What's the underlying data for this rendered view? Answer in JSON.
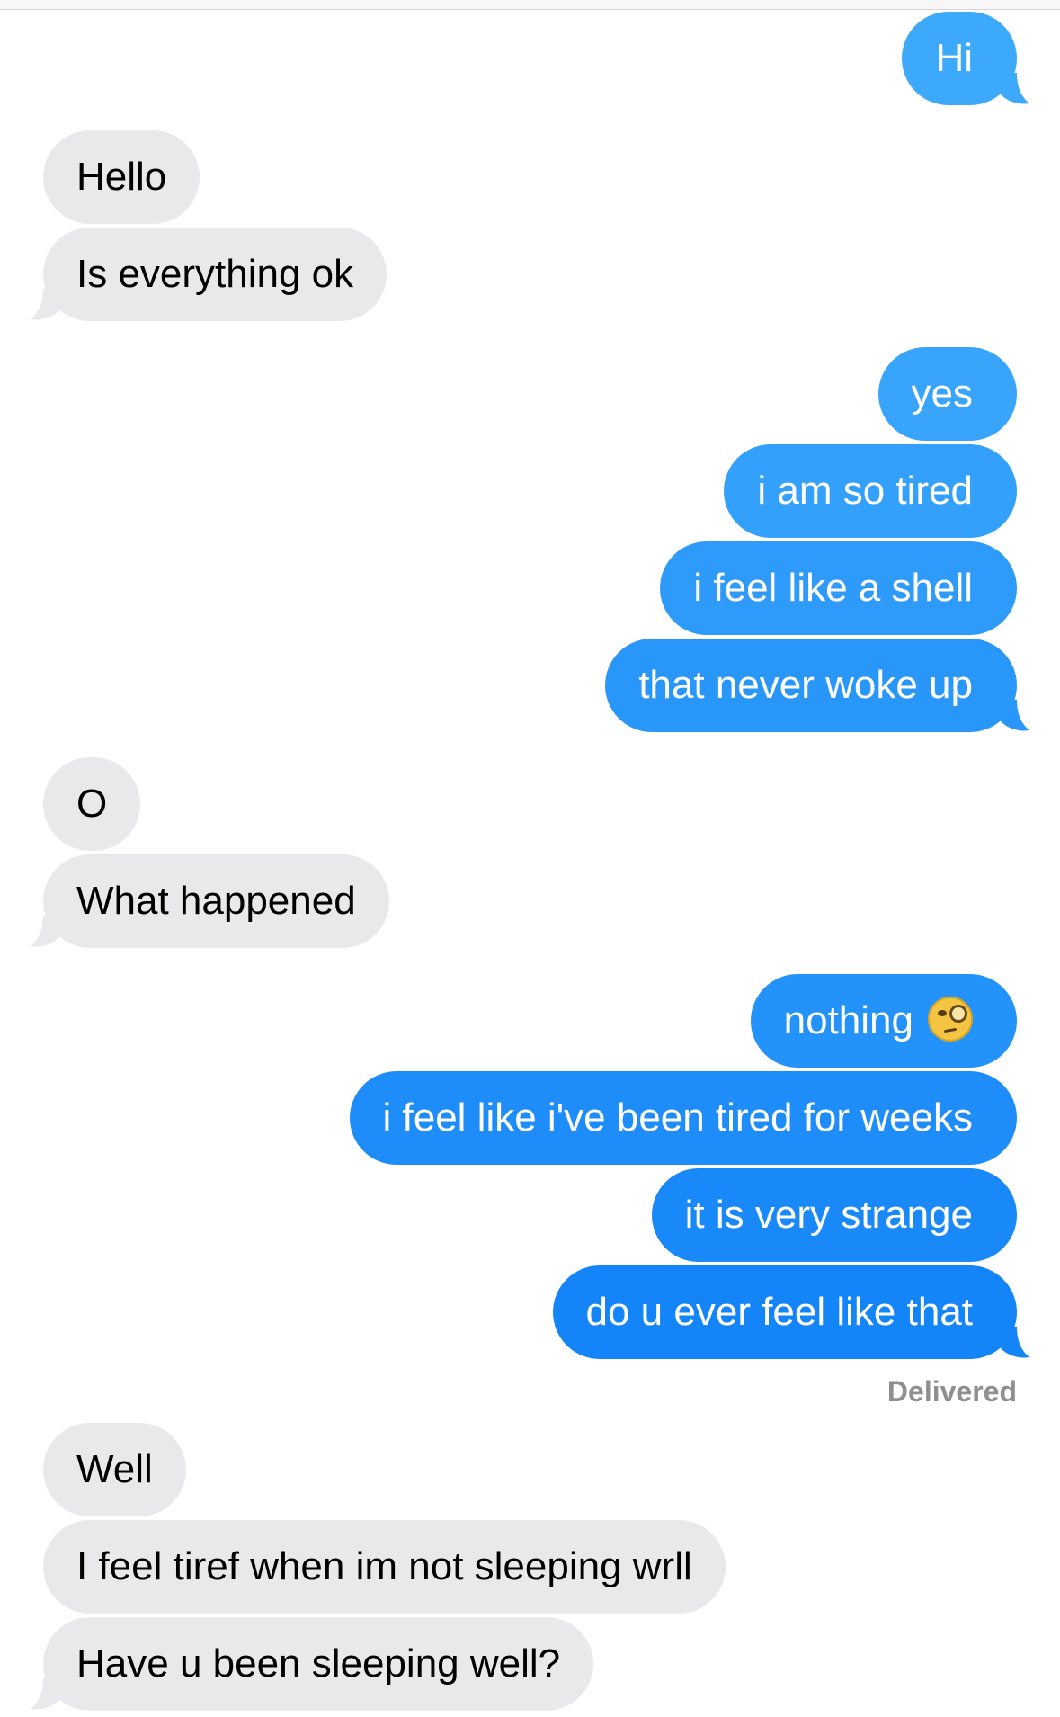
{
  "colors": {
    "outgoing_light": "#3da9fb",
    "outgoing_dark": "#1484f9",
    "incoming_bg": "#e9e9eb",
    "status_text": "#8e8e93"
  },
  "messages": [
    {
      "dir": "out",
      "text": "Hi",
      "tail": true
    },
    {
      "dir": "in",
      "text": "Hello",
      "tail": false
    },
    {
      "dir": "in",
      "text": "Is everything ok",
      "tail": true
    },
    {
      "dir": "out",
      "text": "yes",
      "tail": false
    },
    {
      "dir": "out",
      "text": "i am so tired",
      "tail": false
    },
    {
      "dir": "out",
      "text": "i feel like a shell",
      "tail": false
    },
    {
      "dir": "out",
      "text": "that never woke up",
      "tail": true
    },
    {
      "dir": "in",
      "text": "O",
      "tail": false
    },
    {
      "dir": "in",
      "text": "What happened",
      "tail": true
    },
    {
      "dir": "out",
      "text": "nothing",
      "tail": false,
      "icon": "face-with-monocle-icon"
    },
    {
      "dir": "out",
      "text": "i feel like i've been tired for weeks",
      "tail": false
    },
    {
      "dir": "out",
      "text": "it is very strange",
      "tail": false
    },
    {
      "dir": "out",
      "text": "do u ever feel like that",
      "tail": true
    },
    {
      "dir": "in",
      "text": "Well",
      "tail": false
    },
    {
      "dir": "in",
      "text": "I feel tiref when im not sleeping wrll",
      "tail": false
    },
    {
      "dir": "in",
      "text": "Have u been sleeping well?",
      "tail": true
    }
  ],
  "status": {
    "delivered_label": "Delivered"
  }
}
